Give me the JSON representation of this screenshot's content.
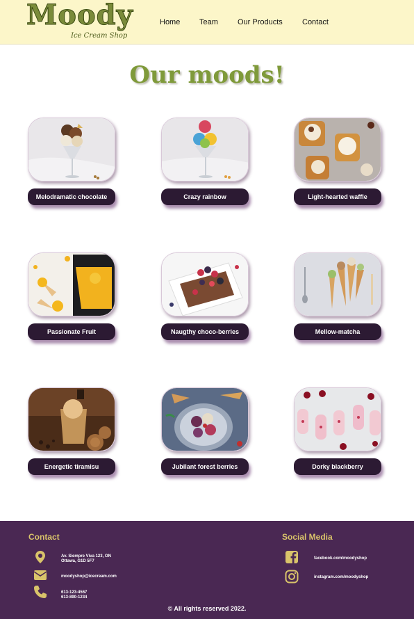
{
  "header": {
    "logo_text": "Moody",
    "logo_sub": "Ice Cream Shop",
    "nav": [
      "Home",
      "Team",
      "Our Products",
      "Contact"
    ]
  },
  "main": {
    "title": "Our moods!",
    "products": [
      "Melodramatic chocolate",
      "Crazy rainbow",
      "Light-hearted waffle",
      "Passionate Fruit",
      "Naugthy choco-berries",
      "Mellow-matcha",
      "Energetic tiramisu",
      "Jubilant forest berries",
      "Dorky blackberry"
    ]
  },
  "footer": {
    "contact_heading": "Contact",
    "address_line1": "Av. Siempre Viva 123, ON",
    "address_line2": "Ottawa, G1D 5F7",
    "email": "moodyshop@icecream.com",
    "phone1": "613-123-4567",
    "phone2": "613-890-1234",
    "social_heading": "Social Media",
    "facebook": "facebook.com/moodyshop",
    "instagram": "instagram.com/moodyshop",
    "copyright": "© All rights reserved 2022."
  },
  "colors": {
    "header_bg": "#fcf6c9",
    "logo_green": "#7a8b3a",
    "title_green": "#7f9a3a",
    "button_dark": "#2c1a33",
    "footer_purple": "#4a2853",
    "footer_gold": "#d9c36a"
  }
}
